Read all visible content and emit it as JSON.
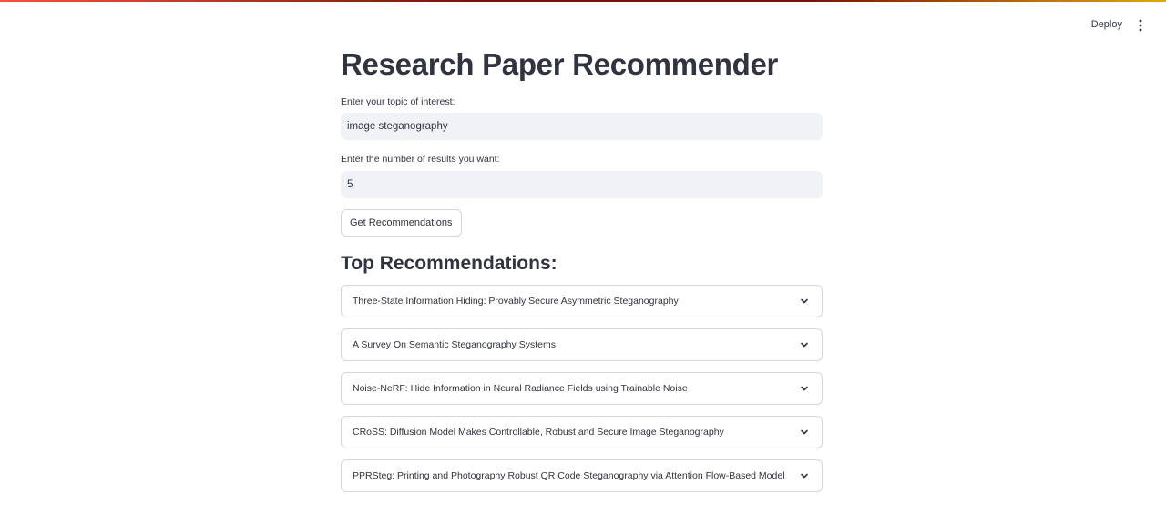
{
  "header": {
    "deploy_label": "Deploy",
    "menu_icon": "vertical-dots-icon"
  },
  "main": {
    "title": "Research Paper Recommender",
    "topic_field": {
      "label": "Enter your topic of interest:",
      "value": "image steganography"
    },
    "count_field": {
      "label": "Enter the number of results you want:",
      "value": "5"
    },
    "submit_label": "Get Recommendations",
    "results_heading": "Top Recommendations:",
    "results": [
      {
        "title": "Three-State Information Hiding: Provably Secure Asymmetric Steganography"
      },
      {
        "title": "A Survey On Semantic Steganography Systems"
      },
      {
        "title": "Noise-NeRF: Hide Information in Neural Radiance Fields using Trainable Noise"
      },
      {
        "title": "CRoSS: Diffusion Model Makes Controllable, Robust and Secure Image Steganography"
      },
      {
        "title": "PPRSteg: Printing and Photography Robust QR Code Steganography via Attention Flow-Based Model"
      }
    ]
  },
  "colors": {
    "accent": "#ff4b4b",
    "input_bg": "#f0f2f6",
    "border": "#d6d6d9",
    "text": "#31333f"
  }
}
